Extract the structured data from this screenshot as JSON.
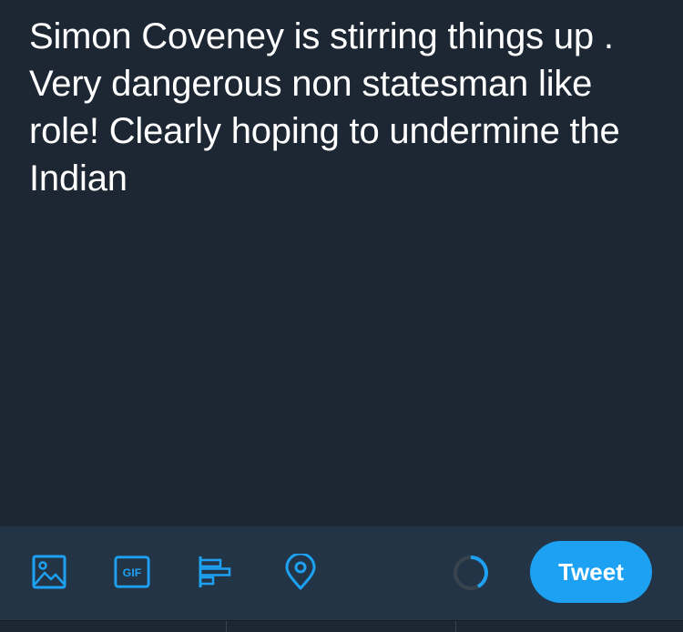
{
  "compose": {
    "text": "Simon Coveney is stirring things up . Very dangerous non statesman like role! Clearly hoping to undermine the Indian"
  },
  "toolbar": {
    "icons": [
      "image-icon",
      "gif-icon",
      "poll-icon",
      "location-icon"
    ],
    "gif_label": "GIF",
    "tweet_label": "Tweet"
  },
  "colors": {
    "background": "#1c2733",
    "toolbar": "#243447",
    "accent": "#1da1f2",
    "text": "#ffffff"
  }
}
